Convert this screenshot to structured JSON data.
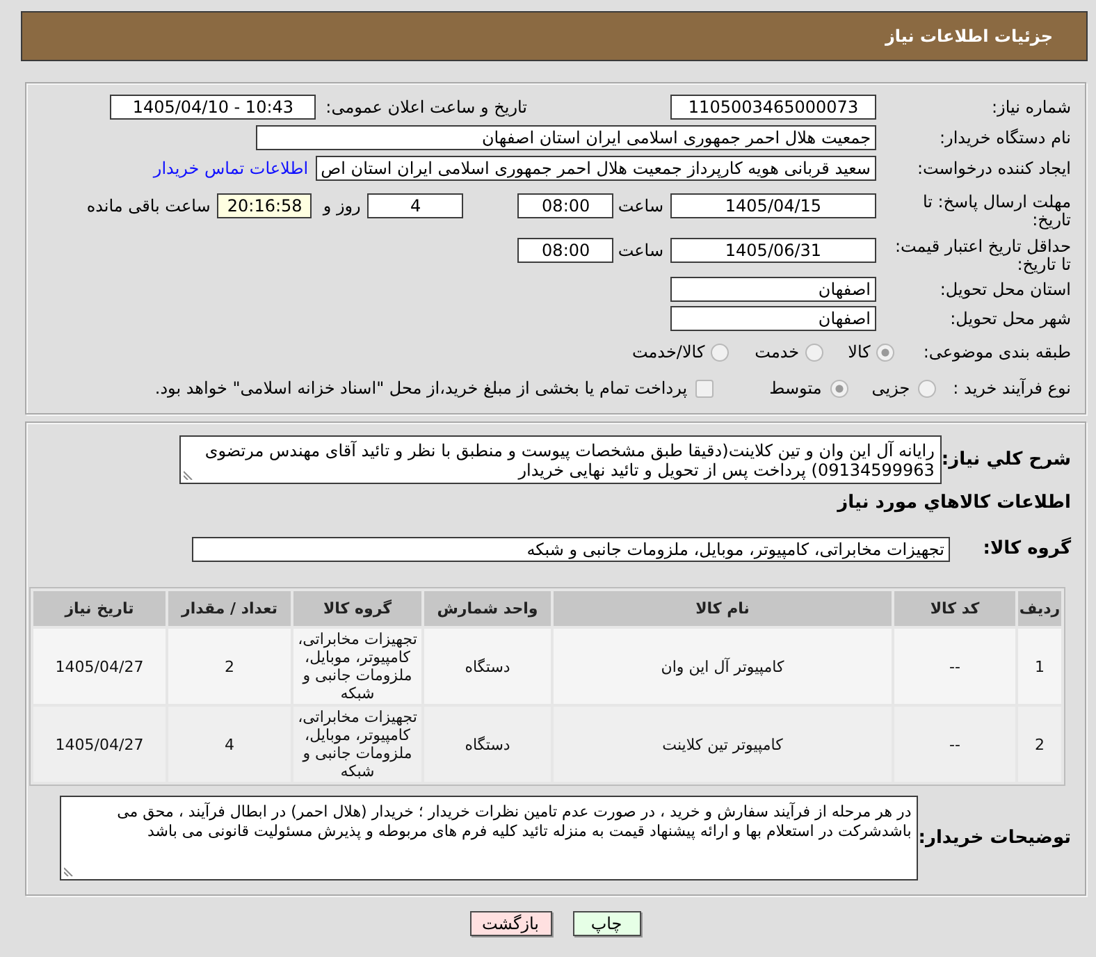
{
  "header": {
    "title": "جزئیات اطلاعات نیاز"
  },
  "need_info": {
    "need_number": {
      "label": "شماره نیاز:",
      "value": "1105003465000073"
    },
    "announce_datetime": {
      "label": "تاریخ و ساعت اعلان عمومی:",
      "value": "1405/04/10 - 10:43"
    },
    "buyer_org": {
      "label": "نام دستگاه خریدار:",
      "value": "جمعیت هلال احمر جمهوری اسلامی ایران استان اصفهان"
    },
    "requester": {
      "label": "ایجاد کننده درخواست:",
      "value": "سعید قربانی هویه کارپرداز جمعیت هلال احمر جمهوری اسلامی ایران استان اص",
      "link": "اطلاعات تماس خریدار"
    },
    "reply_deadline": {
      "label": "مهلت ارسال پاسخ: تا تاریخ:",
      "date": "1405/04/15",
      "time_label": "ساعت",
      "time": "08:00",
      "days": "4",
      "days_label": "روز و",
      "remaining": "20:16:58",
      "remaining_label": "ساعت باقی مانده"
    },
    "price_validity": {
      "label": "حداقل تاریخ اعتبار قیمت: تا تاریخ:",
      "date": "1405/06/31",
      "time_label": "ساعت",
      "time": "08:00"
    },
    "delivery_province": {
      "label": "استان محل تحویل:",
      "value": "اصفهان"
    },
    "delivery_city": {
      "label": "شهر محل تحویل:",
      "value": "اصفهان"
    },
    "subject_category": {
      "label": "طبقه بندی موضوعی:",
      "options": [
        {
          "label": "کالا",
          "selected": true
        },
        {
          "label": "خدمت",
          "selected": false
        },
        {
          "label": "کالا/خدمت",
          "selected": false
        }
      ]
    },
    "purchase_process": {
      "label": "نوع فرآیند خرید :",
      "options": [
        {
          "label": "جزیی",
          "selected": false
        },
        {
          "label": "متوسط",
          "selected": true
        }
      ],
      "treasury_option": {
        "label": "پرداخت تمام یا بخشی از مبلغ خرید،از محل \"اسناد خزانه اسلامی\" خواهد بود.",
        "checked": false
      }
    }
  },
  "description": {
    "label": "شرح کلي نیاز:",
    "lines": [
      "رایانه آل این وان و تین کلاینت(دقیقا طبق مشخصات پیوست و منطبق با نظر و تائید آقای مهندس مرتضوی",
      "09134599963) پرداخت پس از تحویل و تائید نهایی خریدار"
    ]
  },
  "goods": {
    "title": "اطلاعات کالاهاي مورد نیاز",
    "group": {
      "label": "گروه کالا:",
      "value": "تجهیزات مخابراتی، کامپیوتر، موبایل، ملزومات جانبی و شبکه"
    },
    "table": {
      "columns": [
        "ردیف",
        "کد کالا",
        "نام کالا",
        "واحد شمارش",
        "گروه کالا",
        "تعداد / مقدار",
        "تاریخ نیاز"
      ],
      "rows": [
        {
          "cells": [
            "1",
            "--",
            "کامپیوتر آل این وان",
            "دستگاه",
            "تجهیزات مخابراتی، کامپیوتر، موبایل، ملزومات جانبی و شبکه",
            "2",
            "1405/04/27"
          ]
        },
        {
          "cells": [
            "2",
            "--",
            "کامپیوتر تین کلاینت",
            "دستگاه",
            "تجهیزات مخابراتی، کامپیوتر، موبایل، ملزومات جانبی و شبکه",
            "4",
            "1405/04/27"
          ]
        }
      ]
    }
  },
  "buyer_notes": {
    "label": "توضیحات خریدار:",
    "lines": [
      "در هر مرحله از فرآیند سفارش و خرید ، در صورت عدم تامین نظرات خریدار ؛ خریدار (هلال احمر) در ابطال فرآیند ، محق می",
      "باشدشرکت در استعلام بها و ارائه پیشنهاد قیمت به منزله تائید کلیه فرم های مربوطه و پذیرش مسئولیت قانونی می باشد"
    ]
  },
  "buttons": [
    {
      "label": "چاپ",
      "kind": "print"
    },
    {
      "label": "بازگشت",
      "kind": "back"
    }
  ]
}
